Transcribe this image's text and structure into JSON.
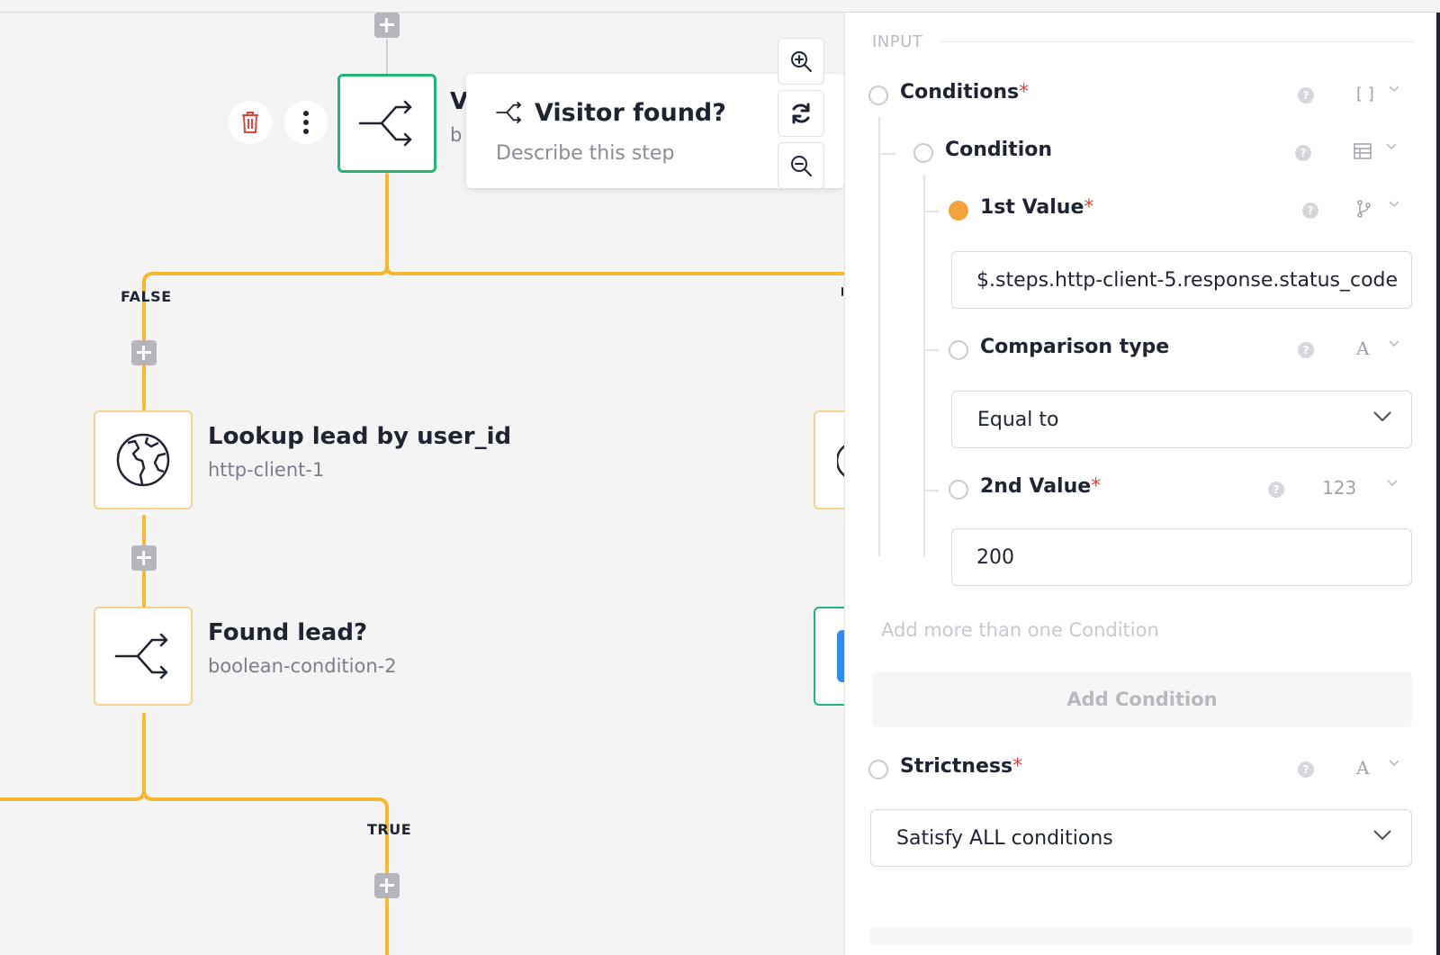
{
  "canvas": {
    "branch_false": "FALSE",
    "branch_true": "TRUE",
    "nodes": [
      {
        "title": "Lookup lead by user_id",
        "subtitle": "http-client-1",
        "icon": "globe-icon"
      },
      {
        "title": "Found lead?",
        "subtitle": "boolean-condition-2",
        "icon": "branch-icon"
      }
    ],
    "selected_node": {
      "title_partial": "V",
      "subtitle_partial": "b",
      "icon": "branch-icon"
    },
    "popover": {
      "title": "Visitor found?",
      "description_placeholder": "Describe this step",
      "icon": "branch-icon"
    },
    "zoom_controls": [
      "zoom-in-icon",
      "refresh-icon",
      "zoom-out-icon"
    ],
    "colors": {
      "wire": "#f7b731",
      "selected_border": "#22b573",
      "node_border": "#f7d28c",
      "delete": "#e0443b"
    }
  },
  "panel": {
    "section": "INPUT",
    "conditions": {
      "label": "Conditions",
      "required": "*",
      "type_glyph": "[ ]",
      "condition": {
        "label": "Condition",
        "first_value": {
          "label": "1st Value",
          "required": "*",
          "value": "$.steps.http-client-5.response.status_code"
        },
        "comparison_type": {
          "label": "Comparison type",
          "type_glyph": "A",
          "selected": "Equal to"
        },
        "second_value": {
          "label": "2nd Value",
          "required": "*",
          "type_glyph": "123",
          "value": "200"
        }
      },
      "hint": "Add more than one Condition",
      "add_button": "Add Condition"
    },
    "strictness": {
      "label": "Strictness",
      "required": "*",
      "type_glyph": "A",
      "selected": "Satisfy ALL conditions"
    },
    "help_glyph": "?",
    "colors": {
      "accent_filled": "#f3a33c",
      "required": "#e0443b"
    }
  }
}
